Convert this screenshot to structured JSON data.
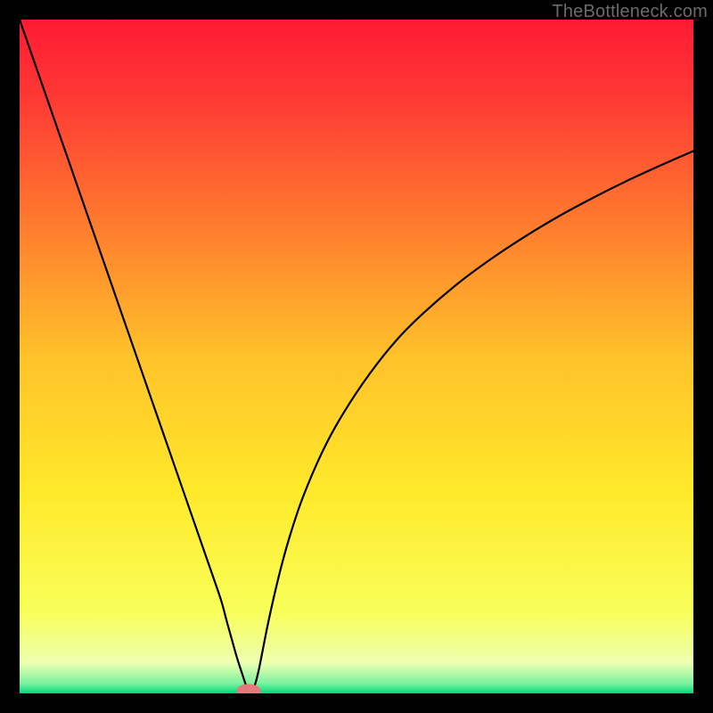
{
  "watermark": "TheBottleneck.com",
  "chart_data": {
    "type": "line",
    "title": "",
    "xlabel": "",
    "ylabel": "",
    "xlim": [
      0,
      100
    ],
    "ylim": [
      0,
      100
    ],
    "background_gradient": {
      "direction": "vertical",
      "stops": [
        {
          "t": 0.0,
          "color": "#ff1a33"
        },
        {
          "t": 0.12,
          "color": "#ff3a34"
        },
        {
          "t": 0.3,
          "color": "#ff7a2e"
        },
        {
          "t": 0.5,
          "color": "#ffc22a"
        },
        {
          "t": 0.7,
          "color": "#ffe92a"
        },
        {
          "t": 0.88,
          "color": "#f8ff5a"
        },
        {
          "t": 0.955,
          "color": "#ecffb0"
        },
        {
          "t": 0.985,
          "color": "#7cf2a0"
        },
        {
          "t": 1.0,
          "color": "#00d97a"
        }
      ]
    },
    "series": [
      {
        "name": "bottleneck-curve",
        "color": "#000000",
        "x": [
          0.0,
          2.5,
          5.0,
          7.5,
          10.0,
          12.5,
          15.0,
          17.5,
          20.0,
          22.5,
          25.0,
          27.5,
          29.0,
          30.0,
          30.8,
          31.5,
          32.2,
          33.0,
          33.5,
          34.0,
          34.5,
          35.0,
          35.5,
          36.0,
          37.0,
          38.5,
          40.0,
          42.0,
          45.0,
          48.0,
          52.0,
          56.0,
          60.0,
          65.0,
          70.0,
          75.0,
          80.0,
          85.0,
          90.0,
          95.0,
          100.0
        ],
        "y": [
          100.0,
          92.8,
          85.6,
          78.4,
          71.2,
          64.0,
          56.8,
          49.6,
          42.4,
          35.2,
          28.0,
          20.8,
          16.5,
          13.5,
          10.5,
          8.0,
          5.5,
          3.0,
          1.5,
          0.3,
          0.3,
          1.5,
          3.5,
          6.0,
          11.0,
          17.5,
          23.0,
          29.0,
          36.0,
          41.5,
          47.5,
          52.5,
          56.5,
          60.8,
          64.5,
          67.8,
          70.8,
          73.5,
          76.0,
          78.3,
          80.5
        ]
      }
    ],
    "marker": {
      "name": "optimal-point",
      "x": 34.0,
      "y": 0.0,
      "color": "#e67a7a",
      "rx": 1.8,
      "ry": 1.0
    }
  }
}
